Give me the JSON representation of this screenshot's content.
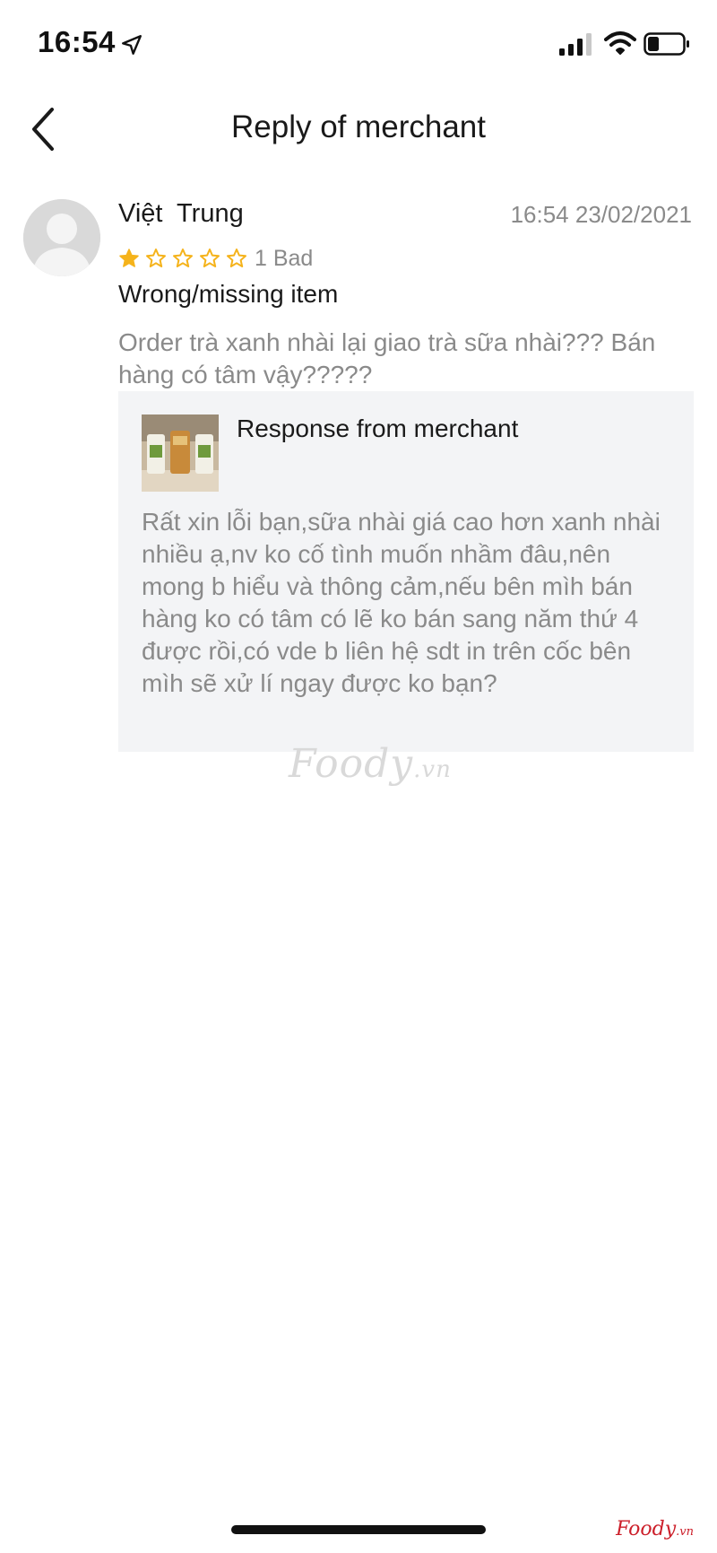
{
  "status_bar": {
    "time": "16:54",
    "icons": [
      "location-arrow-icon",
      "cellular-signal-icon",
      "wifi-icon",
      "battery-icon"
    ]
  },
  "header": {
    "title": "Reply of merchant",
    "back_icon": "chevron-left-icon"
  },
  "review": {
    "author": "Việt  Trung",
    "timestamp": "16:54 23/02/2021",
    "rating": {
      "value": 1,
      "max": 5,
      "label": "1 Bad",
      "star_color": "#f5b31b"
    },
    "title": "Wrong/missing item",
    "body": "Order trà xanh nhài lại giao trà sữa nhài??? Bán hàng có tâm vậy?????"
  },
  "merchant_reply": {
    "heading": "Response from merchant",
    "body": "Rất xin lỗi bạn,sữa nhài giá cao hơn xanh nhài nhiều ạ,nv ko cố tình muốn nhầm đâu,nên mong b hiểu và thông cảm,nếu bên mìh bán hàng ko có tâm có lẽ ko bán sang năm thứ 4 được rồi,có vde b liên hệ sdt in trên cốc bên mìh sẽ xử lí ngay được ko bạn?"
  },
  "watermark": {
    "brand": "Foody",
    "suffix": ".vn",
    "brand_color": "#cc1f2a"
  }
}
